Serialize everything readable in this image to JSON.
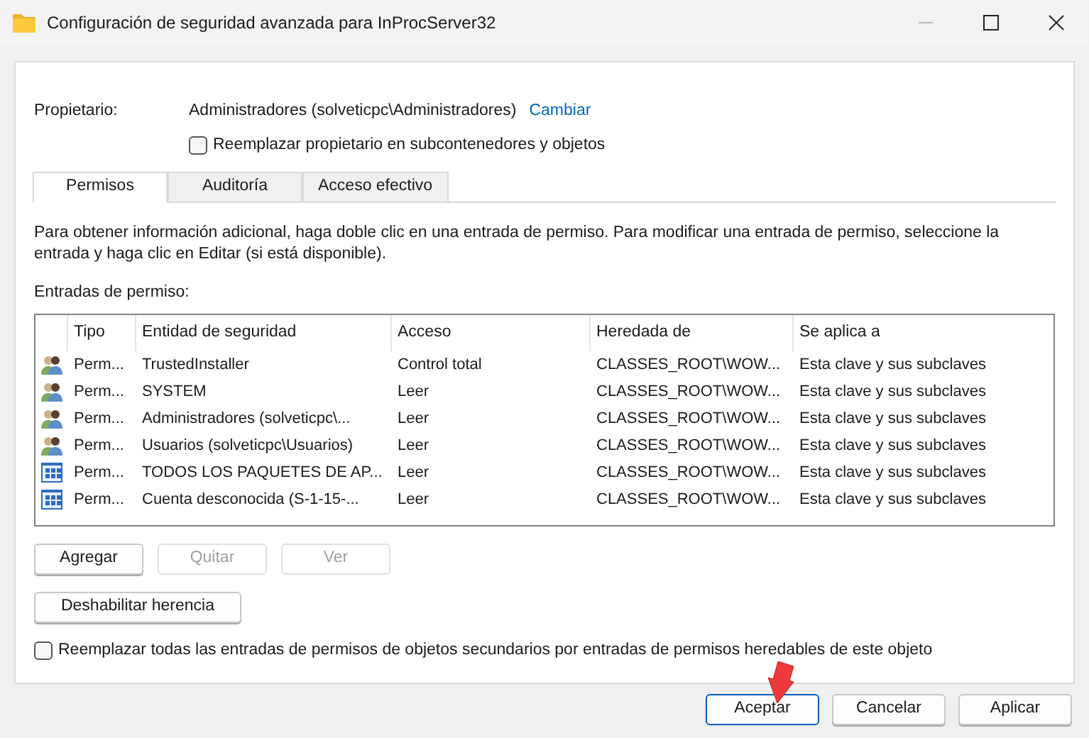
{
  "window": {
    "title": "Configuración de seguridad avanzada para InProcServer32"
  },
  "owner": {
    "label": "Propietario:",
    "value": "Administradores (solveticpc\\Administradores)",
    "link": "Cambiar",
    "replace_checkbox": {
      "label": "Reemplazar propietario en subcontenedores y objetos",
      "checked": false
    }
  },
  "tabs": [
    {
      "label": "Permisos",
      "selected": true
    },
    {
      "label": "Auditoría",
      "selected": false
    },
    {
      "label": "Acceso efectivo",
      "selected": false
    }
  ],
  "info_text": "Para obtener información adicional, haga doble clic en una entrada de permiso. Para modificar una entrada de permiso, seleccione la entrada y haga clic en Editar (si está disponible).",
  "entries_label": "Entradas de permiso:",
  "table": {
    "columns": [
      "Tipo",
      "Entidad de seguridad",
      "Acceso",
      "Heredada de",
      "Se aplica a"
    ],
    "rows": [
      {
        "kind": "users",
        "cells": [
          "Perm...",
          "TrustedInstaller",
          "Control total",
          "CLASSES_ROOT\\WOW...",
          "Esta clave y sus subclaves"
        ]
      },
      {
        "kind": "users",
        "cells": [
          "Perm...",
          "SYSTEM",
          "Leer",
          "CLASSES_ROOT\\WOW...",
          "Esta clave y sus subclaves"
        ]
      },
      {
        "kind": "users",
        "cells": [
          "Perm...",
          "Administradores (solveticpc\\...",
          "Leer",
          "CLASSES_ROOT\\WOW...",
          "Esta clave y sus subclaves"
        ]
      },
      {
        "kind": "users",
        "cells": [
          "Perm...",
          "Usuarios (solveticpc\\Usuarios)",
          "Leer",
          "CLASSES_ROOT\\WOW...",
          "Esta clave y sus subclaves"
        ]
      },
      {
        "kind": "app",
        "cells": [
          "Perm...",
          "TODOS LOS PAQUETES DE AP...",
          "Leer",
          "CLASSES_ROOT\\WOW...",
          "Esta clave y sus subclaves"
        ]
      },
      {
        "kind": "app",
        "cells": [
          "Perm...",
          "Cuenta desconocida (S-1-15-...",
          "Leer",
          "CLASSES_ROOT\\WOW...",
          "Esta clave y sus subclaves"
        ]
      }
    ]
  },
  "entry_buttons": [
    {
      "label": "Agregar",
      "disabled": false
    },
    {
      "label": "Quitar",
      "disabled": true
    },
    {
      "label": "Ver",
      "disabled": true
    }
  ],
  "inheritance_button": "Deshabilitar herencia",
  "replace_children_checkbox": {
    "label": "Reemplazar todas las entradas de permisos de objetos secundarios por entradas de permisos heredables de este objeto",
    "checked": false
  },
  "dialog_buttons": [
    {
      "label": "Aceptar",
      "default": true
    },
    {
      "label": "Cancelar",
      "default": false
    },
    {
      "label": "Aplicar",
      "default": false
    }
  ]
}
